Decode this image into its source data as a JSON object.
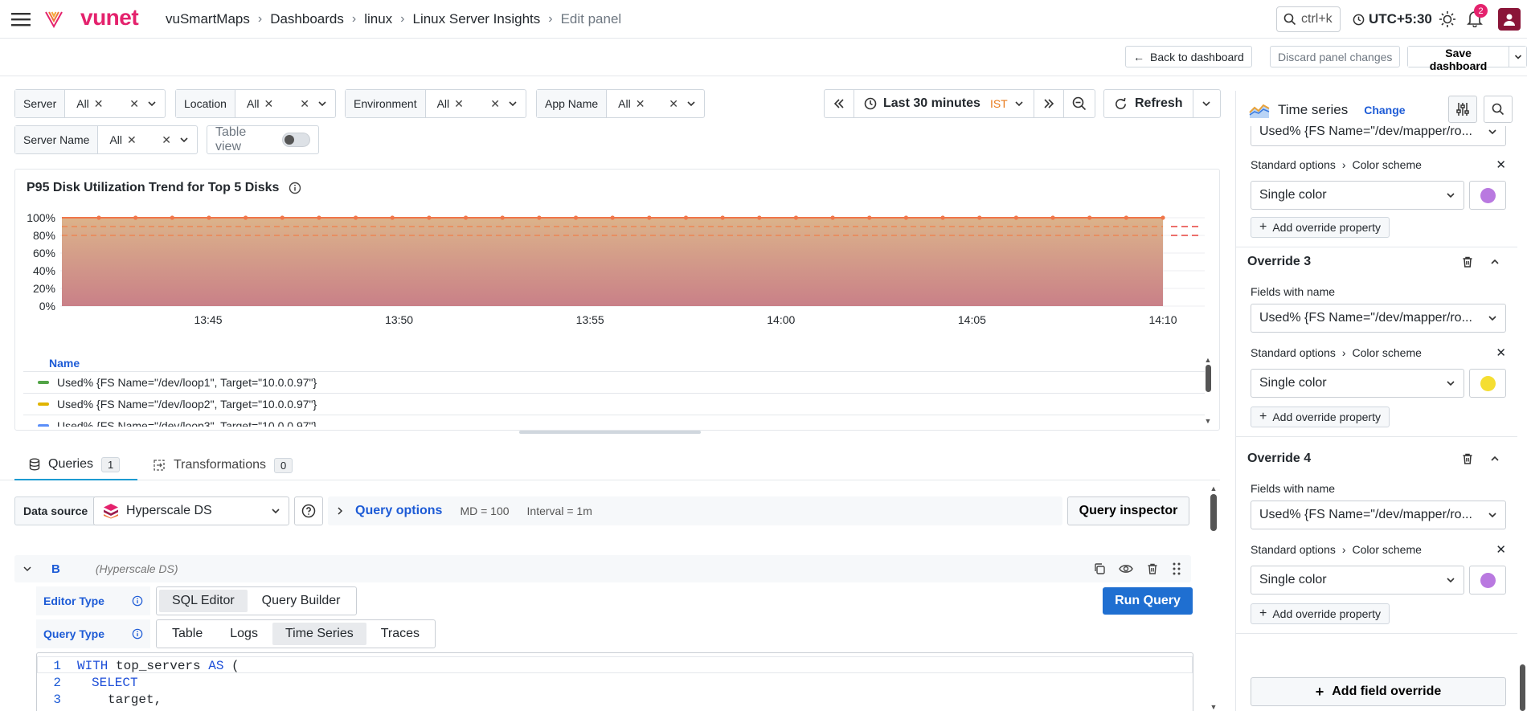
{
  "brand": {
    "name": "vunet",
    "accent": "#e4226d"
  },
  "breadcrumb": [
    "vuSmartMaps",
    "Dashboards",
    "linux",
    "Linux Server Insights"
  ],
  "breadcrumb_current": "Edit panel",
  "search": {
    "placeholder": "ctrl+k"
  },
  "timezone": "UTC+5:30",
  "notifications_count": "2",
  "subbar": {
    "back": "Back to dashboard",
    "discard": "Discard panel changes",
    "save": "Save dashboard"
  },
  "filters": [
    {
      "label": "Server",
      "value": "All"
    },
    {
      "label": "Location",
      "value": "All"
    },
    {
      "label": "Environment",
      "value": "All"
    },
    {
      "label": "App Name",
      "value": "All"
    },
    {
      "label": "Server Name",
      "value": "All"
    }
  ],
  "table_view_label": "Table view",
  "time_picker": {
    "range": "Last 30 minutes",
    "tz": "IST"
  },
  "refresh_label": "Refresh",
  "panel": {
    "title": "P95 Disk Utilization Trend for Top 5 Disks",
    "legend_header": "Name",
    "legend": [
      {
        "name": "Used% {FS Name=\"/dev/loop1\", Target=\"10.0.0.97\"}",
        "color": "#52a447"
      },
      {
        "name": "Used% {FS Name=\"/dev/loop2\", Target=\"10.0.0.97\"}",
        "color": "#e0b400"
      },
      {
        "name": "Used% {FS Name=\"/dev/loop3\", Target=\"10.0.0.97\"}",
        "color": "#5b8ff9"
      }
    ]
  },
  "chart_data": {
    "type": "area",
    "x": [
      "13:45",
      "13:50",
      "13:55",
      "14:00",
      "14:05",
      "14:10"
    ],
    "y_ticks": [
      "100%",
      "80%",
      "60%",
      "40%",
      "20%",
      "0%"
    ],
    "ylim": [
      0,
      100
    ],
    "series": [
      {
        "values": [
          100,
          100,
          100,
          100,
          100,
          100
        ]
      }
    ],
    "thresholds": [
      90,
      80
    ],
    "grid": true
  },
  "query_tabs": [
    {
      "label": "Queries",
      "count": "1"
    },
    {
      "label": "Transformations",
      "count": "0"
    }
  ],
  "datasource": {
    "label": "Data source",
    "value": "Hyperscale DS",
    "query_options": "Query options",
    "md": "MD = 100",
    "interval": "Interval = 1m",
    "inspector": "Query inspector"
  },
  "query_row": {
    "ref": "B",
    "source": "(Hyperscale DS)",
    "editor_type_label": "Editor Type",
    "editor_types": [
      "SQL Editor",
      "Query Builder"
    ],
    "query_type_label": "Query Type",
    "query_types": [
      "Table",
      "Logs",
      "Time Series",
      "Traces"
    ],
    "run": "Run Query"
  },
  "code_lines": [
    {
      "n": "1",
      "kw": "WITH",
      "rest": " top_servers ",
      "kw2": "AS",
      "tail": " ("
    },
    {
      "n": "2",
      "kw": "SELECT",
      "rest": "",
      "kw2": "",
      "tail": ""
    },
    {
      "n": "3",
      "kw": "",
      "rest": "target,",
      "kw2": "",
      "tail": ""
    }
  ],
  "sidebar": {
    "viz": "Time series",
    "change": "Change",
    "top_field": "Used% {FS Name=\"/dev/mapper/ro...",
    "std_options": "Standard options",
    "color_scheme": "Color scheme",
    "single_color": "Single color",
    "add_override_property": "Add override property",
    "fields_with_name": "Fields with name",
    "add_field_override": "Add field override",
    "overrides": [
      {
        "title": "Override 3",
        "field": "Used% {FS Name=\"/dev/mapper/ro...",
        "color": "#f5de32"
      },
      {
        "title": "Override 4",
        "field": "Used% {FS Name=\"/dev/mapper/ro...",
        "color": "#b979e0"
      }
    ],
    "top_color": "#b979e0"
  }
}
